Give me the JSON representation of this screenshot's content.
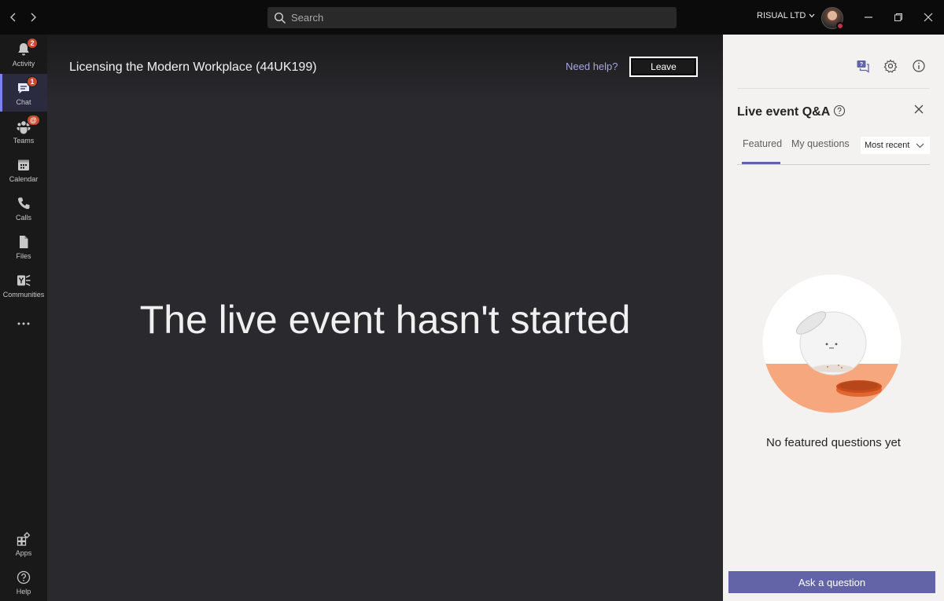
{
  "titlebar": {
    "back_icon": "chevron-left-icon",
    "forward_icon": "chevron-right-icon",
    "search_placeholder": "Search",
    "org_name": "RISUAL LTD",
    "org_chevron": "⌄",
    "minimize": "—",
    "restore": "❐",
    "close": "✕"
  },
  "rail": {
    "items": [
      {
        "label": "Activity",
        "icon": "bell-icon",
        "badge": "2"
      },
      {
        "label": "Chat",
        "icon": "chat-icon",
        "badge": "1",
        "active": true
      },
      {
        "label": "Teams",
        "icon": "teams-icon",
        "badge": "@"
      },
      {
        "label": "Calendar",
        "icon": "calendar-icon"
      },
      {
        "label": "Calls",
        "icon": "phone-icon"
      },
      {
        "label": "Files",
        "icon": "file-icon"
      },
      {
        "label": "Communities",
        "icon": "yammer-icon"
      },
      {
        "label": "...",
        "icon": "more-icon"
      },
      {
        "label": "Apps",
        "icon": "apps-icon"
      },
      {
        "label": "Help",
        "icon": "help-icon"
      }
    ]
  },
  "main": {
    "title": "Licensing the Modern Workplace (44UK199)",
    "need_help": "Need help?",
    "leave": "Leave",
    "hero_text": "The live event hasn't started"
  },
  "panel": {
    "title": "Live event Q&A",
    "tabs": [
      "Featured",
      "My questions"
    ],
    "sort_label": "Most recent",
    "empty_text": "No featured questions yet",
    "ask_button": "Ask a question"
  },
  "colors": {
    "accent": "#6264a7",
    "badge": "#cc4a31",
    "presence_busy": "#c4314b",
    "illustration_orange": "#f7a77d"
  }
}
